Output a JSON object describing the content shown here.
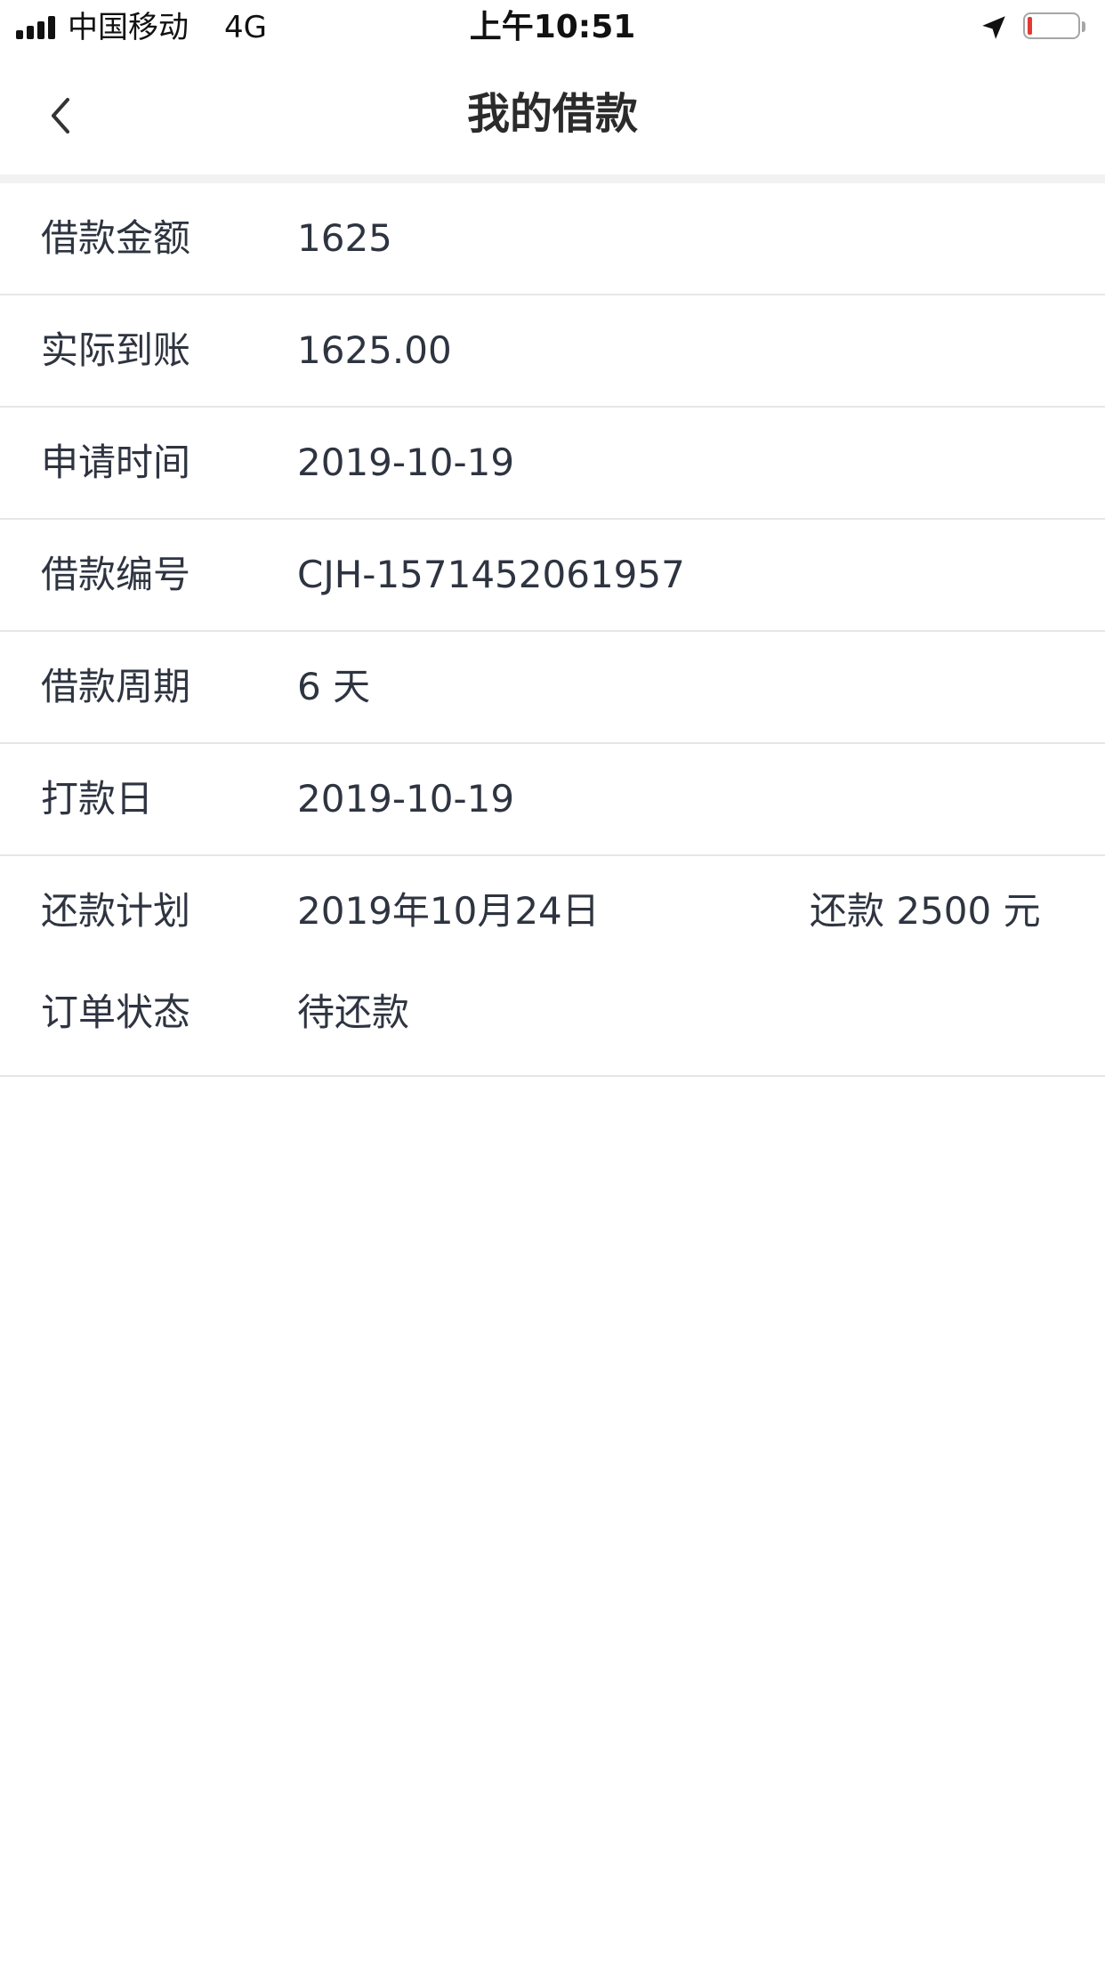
{
  "status_bar": {
    "carrier": "中国移动",
    "network": "4G",
    "time": "上午10:51",
    "battery_level": 0.1,
    "battery_color": "#e53935"
  },
  "nav": {
    "title": "我的借款",
    "back_icon": "chevron-left-icon"
  },
  "details": {
    "loan_amount": {
      "label": "借款金额",
      "value": "1625"
    },
    "actual_received": {
      "label": "实际到账",
      "value": "1625.00"
    },
    "apply_time": {
      "label": "申请时间",
      "value": "2019-10-19"
    },
    "loan_number": {
      "label": "借款编号",
      "value": "CJH-1571452061957"
    },
    "loan_period": {
      "label": "借款周期",
      "value": "6 天"
    },
    "payment_date": {
      "label": "打款日",
      "value": "2019-10-19"
    },
    "repayment_plan": {
      "label": "还款计划",
      "value": "2019年10月24日",
      "extra": "还款 2500 元"
    },
    "order_status": {
      "label": "订单状态",
      "value": "待还款"
    }
  }
}
